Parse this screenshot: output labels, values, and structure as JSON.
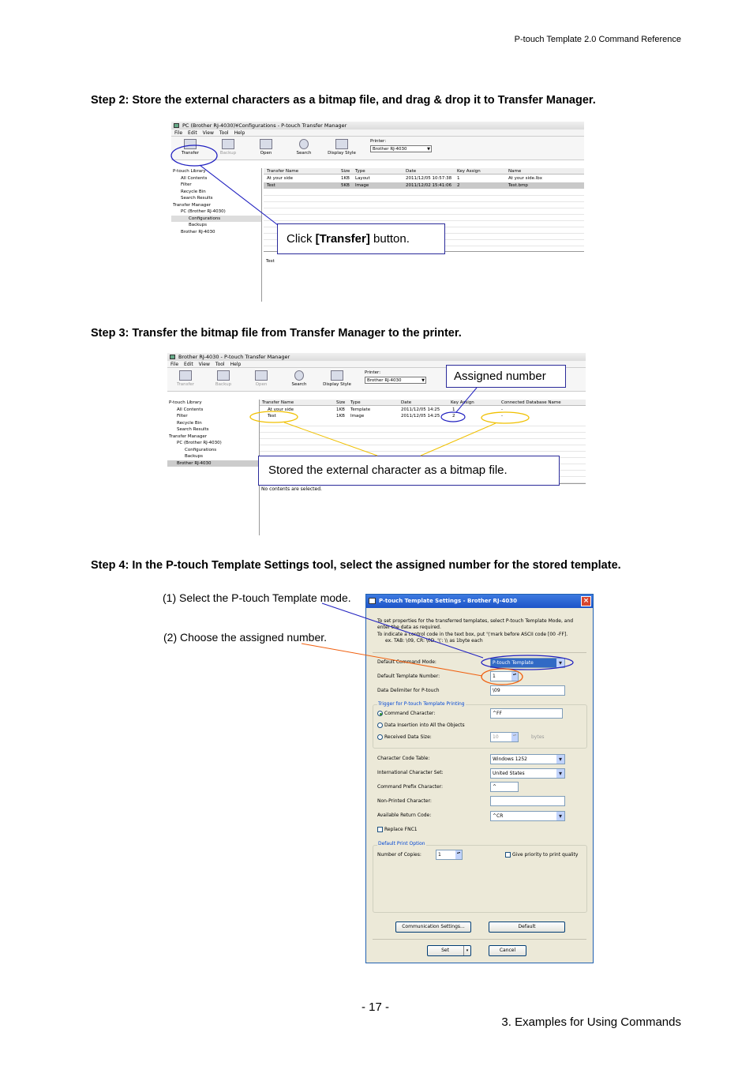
{
  "header": {
    "title": "P-touch Template 2.0 Command Reference"
  },
  "steps": [
    "Step 2: Store the external characters as a bitmap file, and drag & drop it to Transfer Manager.",
    "Step 3: Transfer the bitmap file from Transfer Manager to the printer.",
    "Step 4: In the P-touch Template Settings tool, select the assigned number for the stored template."
  ],
  "window1": {
    "title": "PC (Brother RJ-4030)¥Configurations - P-touch Transfer Manager",
    "menu": [
      "File",
      "Edit",
      "View",
      "Tool",
      "Help"
    ],
    "toolbar": [
      "Transfer",
      "Backup",
      "Open",
      "Search",
      "Display Style"
    ],
    "printer_label": "Printer:",
    "printer_value": "Brother RJ-4030",
    "tree": [
      "P-touch Library",
      "All Contents",
      "Filter",
      "Recycle Bin",
      "Search Results",
      "Transfer Manager",
      "PC (Brother RJ-4030)",
      "Configurations",
      "Backups",
      "Brother RJ-4030"
    ],
    "columns": [
      "Transfer Name",
      "Size",
      "Type",
      "Date",
      "Key Assign",
      "Name"
    ],
    "rows": [
      [
        "At your side",
        "1KB",
        "Layout",
        "2011/12/05 10:57:38",
        "1",
        "At your side.lbx"
      ],
      [
        "Test",
        "5KB",
        "Image",
        "2011/12/02 15:41:06",
        "2",
        "Test.bmp"
      ]
    ],
    "preview_text": "Test",
    "callout_prefix": "Click ",
    "callout_bold": "[Transfer]",
    "callout_suffix": " button."
  },
  "window2": {
    "title": "Brother RJ-4030 - P-touch Transfer Manager",
    "menu": [
      "File",
      "Edit",
      "View",
      "Tool",
      "Help"
    ],
    "toolbar": [
      "Transfer",
      "Backup",
      "Open",
      "Search",
      "Display Style"
    ],
    "printer_label": "Printer:",
    "printer_value": "Brother RJ-4030",
    "tree": [
      "P-touch Library",
      "All Contents",
      "Filter",
      "Recycle Bin",
      "Search Results",
      "Transfer Manager",
      "PC (Brother RJ-4030)",
      "Configurations",
      "Backups",
      "Brother RJ-4030"
    ],
    "columns": [
      "Transfer Name",
      "Size",
      "Type",
      "Date",
      "Key Assign",
      "Connected Database Name"
    ],
    "rows": [
      [
        "At your side",
        "1KB",
        "Template",
        "2011/12/05 14:25",
        "1",
        "-"
      ],
      [
        "Test",
        "1KB",
        "Image",
        "2011/12/05 14:25",
        "2",
        "-"
      ]
    ],
    "status_text": "No contents are selected.",
    "callout_assigned": "Assigned number",
    "callout_stored": "Stored the external character as a bitmap file."
  },
  "dialog": {
    "title": "P-touch Template Settings - Brother RJ-4030",
    "intro_1": "To set properties for the transferred templates, select P-touch Template Mode, and",
    "intro_2": "enter the data as required.",
    "intro_3": "To indicate a control code in the text box, put '\\'mark before ASCII code [00 -FF].",
    "intro_4": "ex. TAB: \\09, CR: \\0D, '\\': \\\\   as 1byte each",
    "mode_label": "Default Command Mode:",
    "mode_value": "P-touch Template",
    "template_label": "Default Template Number:",
    "template_value": "1",
    "delim_label": "Data Delimiter for P-touch",
    "delim_value": "\\09",
    "trigger_group": "Trigger for P-touch Template Printing",
    "trig_cmd": "Command Character:",
    "trig_cmd_value": "^FF",
    "trig_data": "Data Insertion into All the Objects",
    "trig_size": "Received Data Size:",
    "trig_size_value": "10",
    "trig_size_unit": "bytes",
    "charset_label": "Character Code Table:",
    "charset_value": "Windows 1252",
    "intl_label": "International Character Set:",
    "intl_value": "United States",
    "prefix_label": "Command Prefix Character:",
    "prefix_value": "^",
    "nonprint_label": "Non-Printed Character:",
    "return_label": "Available Return Code:",
    "return_value": "^CR",
    "replace_label": "Replace FNC1",
    "print_group": "Default Print Option",
    "copies_label": "Number of Copies:",
    "copies_value": "1",
    "priority_label": "Give priority to print quality",
    "btn_comm": "Communication Settings...",
    "btn_default": "Default",
    "btn_set": "Set",
    "btn_cancel": "Cancel"
  },
  "labels": {
    "select_mode": "(1) Select the P-touch Template mode.",
    "choose_number": "(2) Choose the assigned number."
  },
  "footer": {
    "page": "- 17 -",
    "section": "3. Examples for Using Commands"
  }
}
